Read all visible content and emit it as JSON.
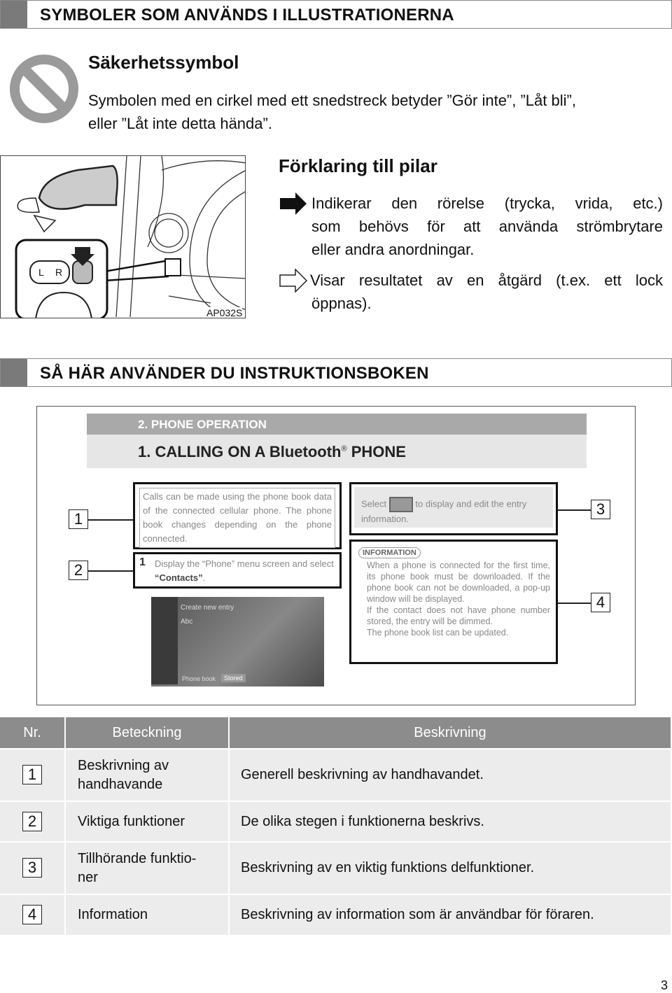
{
  "section1": {
    "title": "SYMBOLER SOM ANVÄNDS I ILLUSTRATIONERNA"
  },
  "safety": {
    "icon": "prohibited-icon",
    "title": "Säkerhetssymbol",
    "text_line1": "Symbolen med en cirkel med ett snedstreck betyder ”Gör inte”, ”Låt bli”,",
    "text_line2": "eller ”Låt inte detta hända”."
  },
  "illustration": {
    "code": "AP032S",
    "switch_left": "L",
    "switch_right": "R"
  },
  "arrows": {
    "title": "Förklaring till pilar",
    "items": [
      {
        "icon": "solid-arrow-icon",
        "line1": "Indikerar den rörelse (trycka, vrida, etc.)",
        "line2": "som behövs för att använda strömbrytare",
        "line3": "eller andra anordningar."
      },
      {
        "icon": "outline-arrow-icon",
        "line1": "Visar resultatet av en åtgärd (t.ex. ett lock",
        "line2": "öppnas)."
      }
    ]
  },
  "section2": {
    "title": "SÅ HÄR ANVÄNDER DU INSTRUKTIONSBOKEN"
  },
  "example": {
    "chapter": "2. PHONE OPERATION",
    "title": "1. CALLING ON A Bluetooth",
    "title_reg": "®",
    "title_end": " PHONE",
    "box1": "Calls can be made using the phone book data of the connected cellular phone. The phone book changes depending on the phone connected.",
    "box2_num": "1",
    "box2": "Display the “Phone” menu screen and select ",
    "box2_bold": "“Contacts”",
    "box2_end": ".",
    "box3_pre": "Select",
    "box3_post": "to display and edit the entry information.",
    "info_label": "INFORMATION",
    "info_items": [
      "When a phone is connected for the first time, its phone book must be downloaded. If the phone book can not be downloaded, a pop-up window will be displayed.",
      "If the contact does not have phone number stored, the entry will be dimmed.",
      "The phone book list can be updated."
    ],
    "screen": {
      "create": "Create new entry",
      "entry": "Abc",
      "tab1": "Phone book",
      "tab2": "Stored"
    },
    "callouts": [
      "1",
      "2",
      "3",
      "4"
    ]
  },
  "table": {
    "headers": [
      "Nr.",
      "Beteckning",
      "Beskrivning"
    ],
    "rows": [
      {
        "nr": "1",
        "name": "Beskrivning av handhavande",
        "desc": "Generell beskrivning av handhavandet."
      },
      {
        "nr": "2",
        "name": "Viktiga funktioner",
        "desc": "De olika stegen i funktionerna beskrivs."
      },
      {
        "nr": "3",
        "name": "Tillhörande funktio-ner",
        "desc": "Beskrivning av en viktig funktions delfunktioner."
      },
      {
        "nr": "4",
        "name": "Information",
        "desc": "Beskrivning av information som är användbar för föraren."
      }
    ]
  },
  "page_number": "3"
}
